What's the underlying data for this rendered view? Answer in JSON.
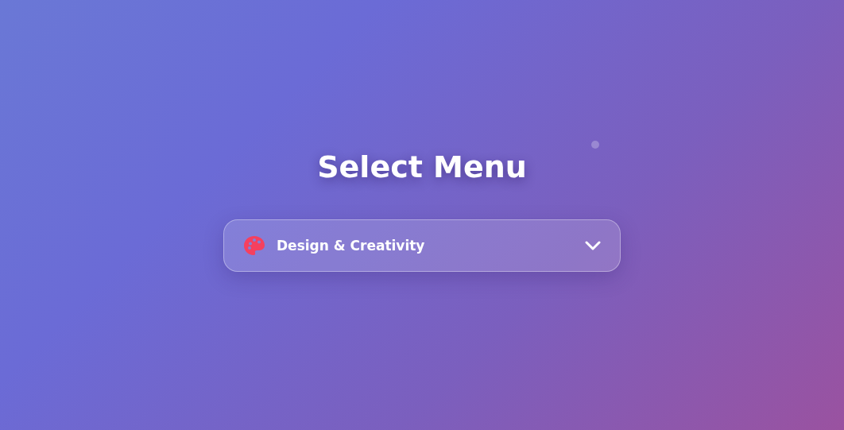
{
  "title": "Select Menu",
  "select": {
    "value": "Design & Creativity",
    "expanded": false
  }
}
